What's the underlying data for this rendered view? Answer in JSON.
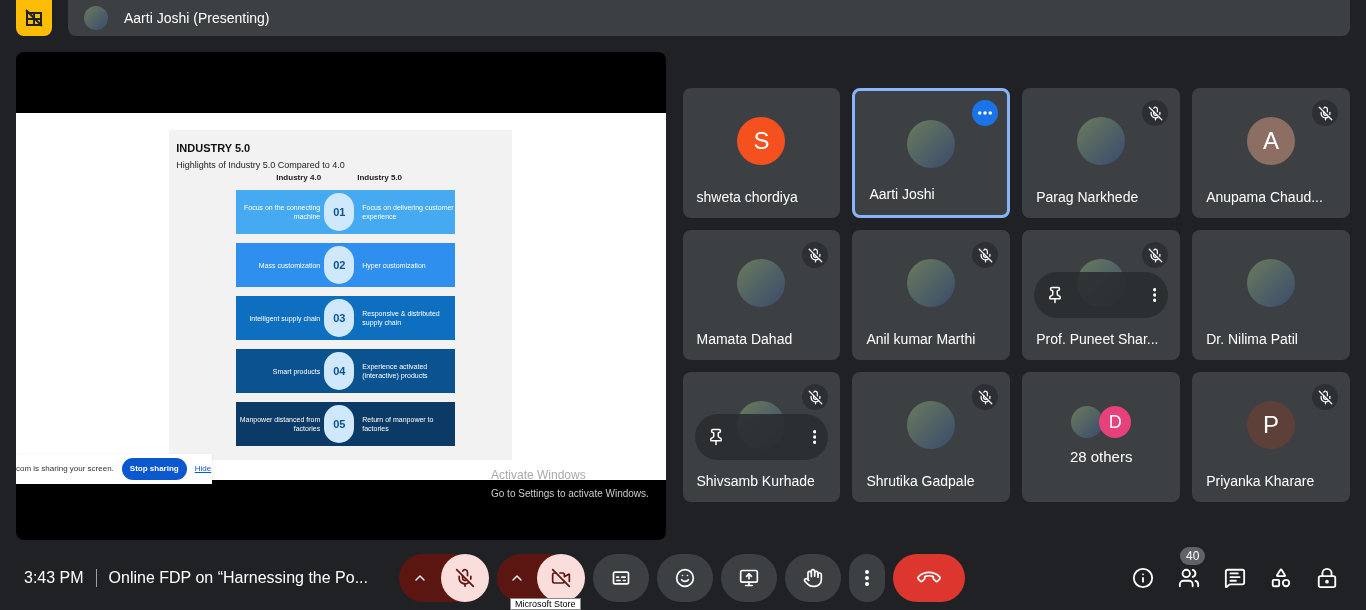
{
  "top_bar": {
    "presenter": "Aarti Joshi (Presenting)"
  },
  "slide": {
    "title": "INDUSTRY 5.0",
    "subtitle": "Highlights of Industry 5.0 Compared to 4.0",
    "col_left": "Industry 4.0",
    "col_right": "Industry 5.0",
    "rows": [
      {
        "left": "Focus on the connecting machine",
        "number": "01",
        "right": "Focus on delivering customer experience",
        "color": "#46aaf2"
      },
      {
        "left": "Mass customization",
        "number": "02",
        "right": "Hyper customization",
        "color": "#2f8fee"
      },
      {
        "left": "Intelligent supply chain",
        "number": "03",
        "right": "Responsive & distributed supply chain",
        "color": "#0e6fc0"
      },
      {
        "left": "Smart products",
        "number": "04",
        "right": "Experience activated (interactive) products",
        "color": "#0b5290"
      },
      {
        "left": "Manpower distanced from factories",
        "number": "05",
        "right": "Return of manpower to factories",
        "color": "#0b3a66"
      }
    ]
  },
  "share_notice": {
    "text": "com is sharing your screen.",
    "stop_button": "Stop sharing",
    "hide_link": "Hide"
  },
  "activation_watermark": {
    "title": "Activate Windows",
    "subtitle": "Go to Settings to activate Windows."
  },
  "tiles": [
    {
      "kind": "person",
      "name": "shweta chordiya",
      "letter": "S",
      "color": "#f4511e",
      "muted": false,
      "selected": false,
      "hover_controls": false
    },
    {
      "kind": "person",
      "name": "Aarti Joshi",
      "muted": false,
      "selected": true,
      "hover_controls": false
    },
    {
      "kind": "person",
      "name": "Parag Narkhede",
      "muted": true,
      "selected": false,
      "hover_controls": false
    },
    {
      "kind": "person",
      "name": "Anupama Chaud...",
      "letter": "A",
      "color": "#8d6e63",
      "muted": true,
      "selected": false,
      "hover_controls": false
    },
    {
      "kind": "person",
      "name": "Mamata Dahad",
      "muted": true,
      "selected": false,
      "hover_controls": false
    },
    {
      "kind": "person",
      "name": "Anil kumar Marthi",
      "muted": true,
      "selected": false,
      "hover_controls": false
    },
    {
      "kind": "person",
      "name": "Prof. Puneet Shar...",
      "muted": true,
      "selected": false,
      "hover_controls": true
    },
    {
      "kind": "person",
      "name": "Dr. Nilima Patil",
      "muted": false,
      "selected": false,
      "hover_controls": false
    },
    {
      "kind": "person",
      "name": "Shivsamb Kurhade",
      "muted": true,
      "selected": false,
      "hover_controls": true
    },
    {
      "kind": "person",
      "name": "Shrutika Gadpale",
      "muted": true,
      "selected": false,
      "hover_controls": false
    },
    {
      "kind": "others",
      "name": "28 others",
      "letter": "D",
      "color": "#e8407a"
    },
    {
      "kind": "person",
      "name": "Priyanka Kharare",
      "letter": "P",
      "color": "#5d4037",
      "muted": true,
      "selected": false,
      "hover_controls": false
    }
  ],
  "bottom_bar": {
    "time": "3:43 PM",
    "meeting_title": "Online FDP on “Harnessing the Po...",
    "mic_on": false,
    "camera_on": false,
    "participant_count": "40",
    "tooltip": "Microsoft Store"
  }
}
